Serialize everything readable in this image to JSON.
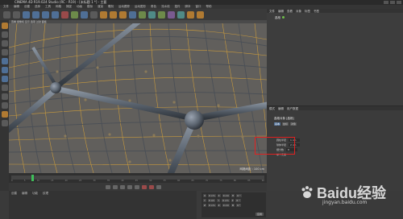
{
  "window": {
    "title": "CINEMA 4D R19.024 Studio (RC - R19) - [未标题 1 *] - 主要"
  },
  "menubar": {
    "items": [
      "文件",
      "编辑",
      "创建",
      "选择",
      "工具",
      "网格",
      "捕捉",
      "动画",
      "模拟",
      "渲染",
      "雕刻",
      "运动跟踪",
      "运动图形",
      "角色",
      "流水线",
      "插件",
      "脚本",
      "窗口",
      "帮助"
    ]
  },
  "viewport": {
    "menu": "查看 摄像机 显示 选项 过滤 面板",
    "status": "网格间距 : 100 cm"
  },
  "timeline": {
    "ticks": [
      "0",
      "5",
      "10",
      "15",
      "20",
      "25",
      "30",
      "35",
      "40",
      "45",
      "50",
      "55",
      "60",
      "65",
      "70",
      "75",
      "80",
      "85",
      "90"
    ]
  },
  "material": {
    "tabs": [
      "创建",
      "编辑",
      "功能",
      "纹理"
    ]
  },
  "coordinates": {
    "rows": [
      [
        "X",
        "0 cm",
        "X",
        "0 cm",
        "H",
        "0 °"
      ],
      [
        "Y",
        "0 cm",
        "Y",
        "0 cm",
        "P",
        "0 °"
      ],
      [
        "Z",
        "0 cm",
        "Z",
        "0 cm",
        "B",
        "0 °"
      ]
    ],
    "apply": "应用"
  },
  "object_manager": {
    "tabs": [
      "文件",
      "编辑",
      "查看",
      "对象",
      "标签",
      "书签"
    ],
    "item": "晶格"
  },
  "attribute_manager": {
    "tabs": [
      "模式",
      "编辑",
      "用户数据"
    ],
    "header": "晶格对象 [晶格]",
    "subtabs": [
      "基本",
      "坐标",
      "对象"
    ],
    "rows": [
      {
        "label": "圆柱半径",
        "value": "1 cm"
      },
      {
        "label": "球体半径",
        "value": "2 cm"
      },
      {
        "label": "细分数",
        "value": "8"
      },
      {
        "label": "单个元素",
        "value": ""
      }
    ]
  },
  "watermark": {
    "brand": "Baidu经验",
    "url": "jingyan.baidu.com"
  },
  "colors": {
    "accent": "#d4a13a",
    "highlight": "#e02020",
    "timeline_marker": "#3fbf5a"
  }
}
